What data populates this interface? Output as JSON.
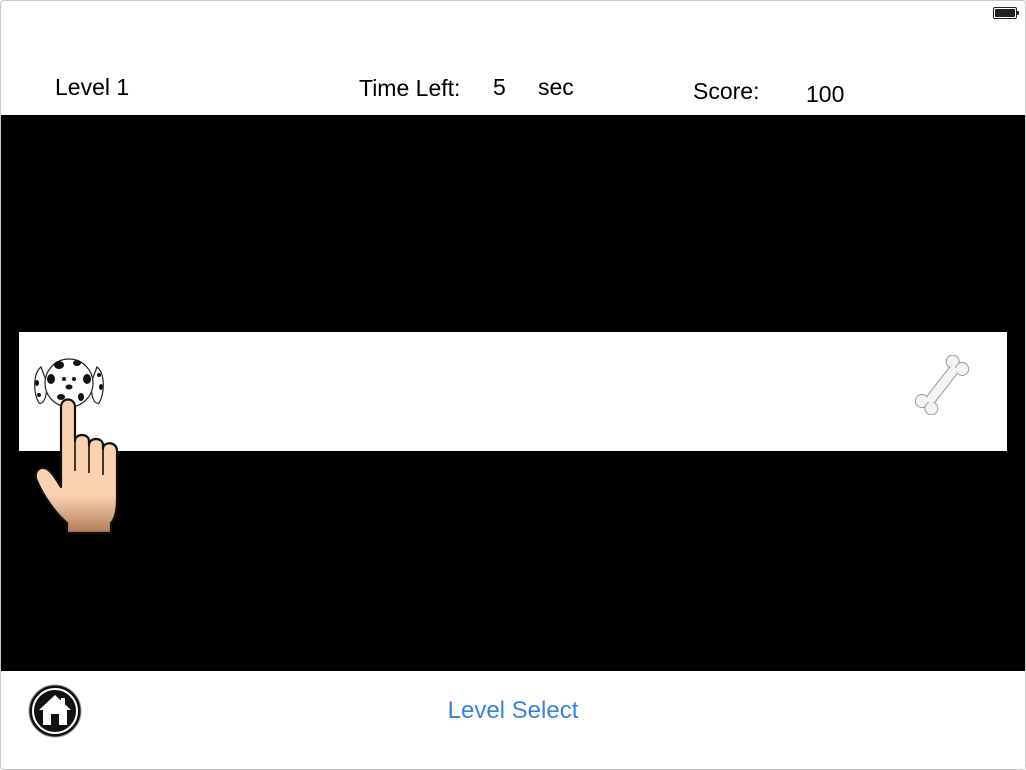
{
  "hud": {
    "level_label": "Level 1",
    "time_label": "Time Left:",
    "time_value": "5",
    "time_unit": "sec",
    "score_label": "Score:",
    "score_value": "100"
  },
  "status_bar": {
    "battery_level": 1.0,
    "battery_icon": "battery-icon"
  },
  "game": {
    "player_sprite": "dalmatian-dog-icon",
    "goal_sprite": "bone-icon",
    "hint_sprite": "pointing-hand-icon",
    "colors": {
      "background": "#000000",
      "track": "#ffffff",
      "hand_skin": "#fbd2b0"
    }
  },
  "footer": {
    "home_icon": "home-icon",
    "level_select_label": "Level Select",
    "link_color": "#3a82e0"
  }
}
